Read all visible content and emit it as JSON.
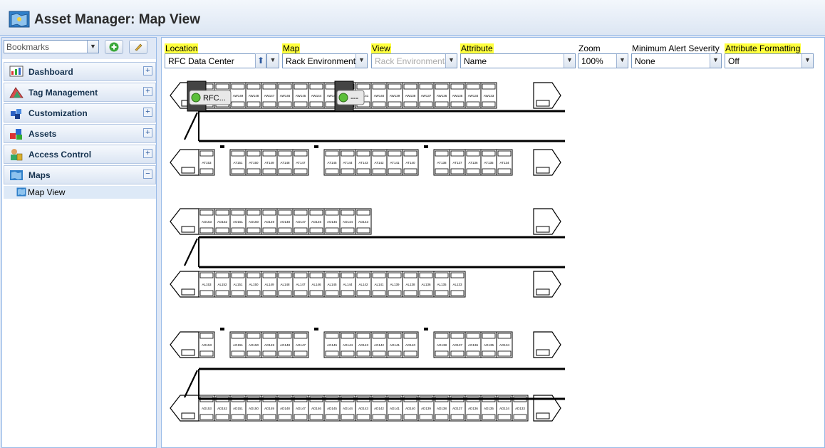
{
  "app": {
    "title": "Asset Manager: Map View"
  },
  "sidebar": {
    "bookmarks": {
      "value": "Bookmarks"
    },
    "items": [
      {
        "label": "Dashboard",
        "toggle": "+",
        "icon": "dashboard-icon"
      },
      {
        "label": "Tag Management",
        "toggle": "+",
        "icon": "tag-management-icon"
      },
      {
        "label": "Customization",
        "toggle": "+",
        "icon": "customization-icon"
      },
      {
        "label": "Assets",
        "toggle": "+",
        "icon": "assets-icon"
      },
      {
        "label": "Access Control",
        "toggle": "+",
        "icon": "access-control-icon"
      },
      {
        "label": "Maps",
        "toggle": "−",
        "icon": "maps-icon"
      }
    ],
    "sub_items": [
      {
        "label": "Map View",
        "icon": "map-view-icon"
      }
    ]
  },
  "filters": {
    "location": {
      "label": "Location",
      "value": "RFC Data Center"
    },
    "map": {
      "label": "Map",
      "value": "Rack Environmental"
    },
    "view": {
      "label": "View",
      "value": "Rack Environmental"
    },
    "attribute": {
      "label": "Attribute",
      "value": "Name"
    },
    "zoom": {
      "label": "Zoom",
      "value": "100%"
    },
    "severity": {
      "label": "Minimum Alert Severity",
      "value": "None"
    },
    "formatting": {
      "label": "Attribute Formatting",
      "value": "Off"
    }
  },
  "map": {
    "badges": [
      {
        "label": "RFC..."
      },
      {
        "label": "---"
      }
    ],
    "rows": [
      {
        "racks": [
          "AW151",
          "AW150",
          "AW149",
          "AW148",
          "AW147",
          "AW146",
          "AW145",
          "AW144",
          "AW143",
          "AW142",
          "AW141",
          "AW140",
          "AW139",
          "AW138",
          "AW137",
          "AW136",
          "AW135",
          "AW134",
          "AW133"
        ]
      },
      {
        "racks": [
          "AT153",
          "",
          "AT151",
          "AT150",
          "AT149",
          "AT148",
          "AT147",
          "",
          "AT145",
          "AT144",
          "AT143",
          "AT142",
          "AT141",
          "AT140",
          "",
          "AT138",
          "AT137",
          "AT136",
          "AT135",
          "AT134"
        ]
      },
      {
        "racks": [
          "AO153",
          "AO152",
          "AO151",
          "AO150",
          "AO149",
          "AO148",
          "AO147",
          "AO146",
          "AO145",
          "AO144",
          "AO143"
        ]
      },
      {
        "racks": [
          "AL153",
          "AL152",
          "AL151",
          "AL150",
          "AL149",
          "AL148",
          "AL147",
          "AL146",
          "AL145",
          "AL144",
          "AL142",
          "AL141",
          "AL139",
          "AL138",
          "AL136",
          "AL135",
          "AL133"
        ]
      },
      {
        "racks": [
          "AG153",
          "",
          "AG151",
          "AG150",
          "AG149",
          "AG148",
          "AG147",
          "",
          "AG145",
          "AG144",
          "AG143",
          "AG142",
          "AG141",
          "AG140",
          "",
          "AG138",
          "AG137",
          "AG136",
          "AG135",
          "AG134"
        ]
      },
      {
        "racks": [
          "AD153",
          "AD152",
          "AD151",
          "AD150",
          "AD149",
          "AD148",
          "AD147",
          "AD146",
          "AD145",
          "AD144",
          "AD143",
          "AD142",
          "AD141",
          "AD140",
          "AD139",
          "AD138",
          "AD137",
          "AD136",
          "AD135",
          "AD134",
          "AD133"
        ]
      }
    ]
  }
}
